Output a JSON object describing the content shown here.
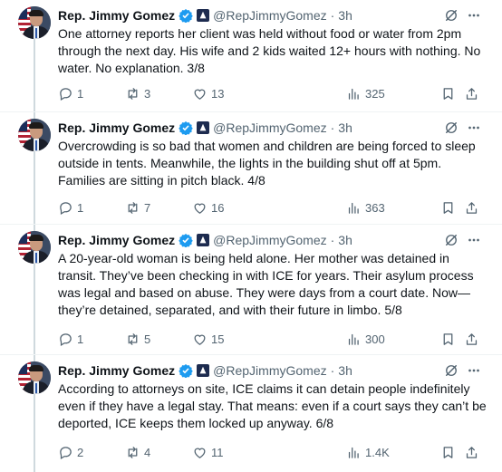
{
  "colors": {
    "text": "#0f1419",
    "muted": "#536471",
    "verified": "#1d9bf0",
    "separator": "#eff3f4"
  },
  "icons": {
    "verified": "verified-badge-icon",
    "affiliate": "government-affiliate-icon",
    "grok": "grok-icon",
    "more": "more-icon",
    "reply": "reply-icon",
    "retweet": "retweet-icon",
    "like": "like-icon",
    "views": "views-icon",
    "bookmark": "bookmark-icon",
    "share": "share-icon"
  },
  "tweets": [
    {
      "author": "Rep. Jimmy Gomez",
      "handle": "@RepJimmyGomez",
      "separator": "·",
      "time": "3h",
      "text": "One attorney reports her client was held without food or water from 2pm through the next day. His wife and 2 kids waited 12+ hours with nothing. No water. No explanation. 3/8",
      "replies": "1",
      "retweets": "3",
      "likes": "13",
      "views": "325"
    },
    {
      "author": "Rep. Jimmy Gomez",
      "handle": "@RepJimmyGomez",
      "separator": "·",
      "time": "3h",
      "text": "Overcrowding is so bad that women and children are being forced to sleep outside in tents. Meanwhile, the lights in the building shut off at 5pm. Families are sitting in pitch black. 4/8",
      "replies": "1",
      "retweets": "7",
      "likes": "16",
      "views": "363"
    },
    {
      "author": "Rep. Jimmy Gomez",
      "handle": "@RepJimmyGomez",
      "separator": "·",
      "time": "3h",
      "text": "A 20-year-old woman is being held alone. Her mother was detained in transit. They’ve been checking in with ICE for years. Their asylum process was legal and based on abuse. They were days from a court date. Now—they’re detained, separated, and with their future in limbo. 5/8",
      "replies": "1",
      "retweets": "5",
      "likes": "15",
      "views": "300"
    },
    {
      "author": "Rep. Jimmy Gomez",
      "handle": "@RepJimmyGomez",
      "separator": "·",
      "time": "3h",
      "text": "According to attorneys on site, ICE claims it can detain people indefinitely even if they have a legal stay. That means: even if a court says they can’t be deported, ICE keeps them locked up anyway. 6/8",
      "replies": "2",
      "retweets": "4",
      "likes": "11",
      "views": "1.4K"
    }
  ]
}
